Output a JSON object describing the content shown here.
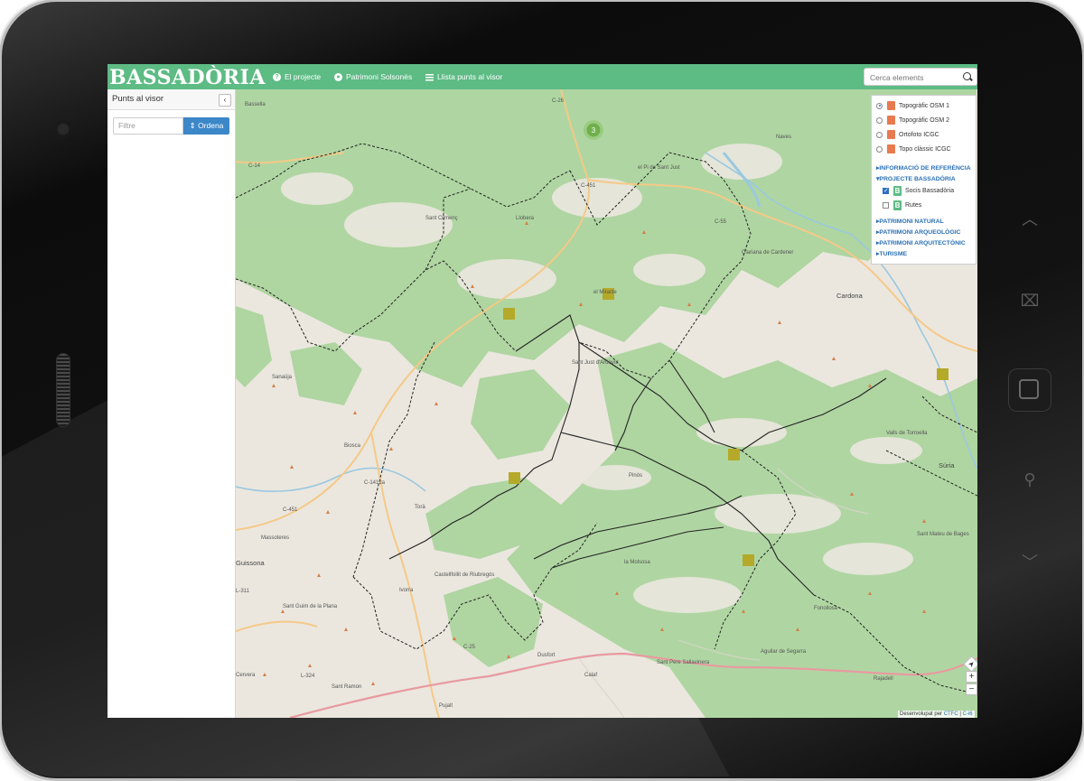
{
  "app": {
    "logo": "BASSADÒRIA"
  },
  "nav": {
    "items": [
      {
        "label": "El projecte",
        "icon": "question-icon"
      },
      {
        "label": "Patrimoni Solsonès",
        "icon": "globe-icon"
      },
      {
        "label": "Llista punts al visor",
        "icon": "list-icon"
      }
    ],
    "search_placeholder": "Cerca elements"
  },
  "sidebar": {
    "title": "Punts al visor",
    "collapse_symbol": "‹",
    "filter_placeholder": "Filtre",
    "sort_label": "Ordena"
  },
  "layers": {
    "base": [
      {
        "label": "Topogràfic OSM 1",
        "selected": true
      },
      {
        "label": "Topogràfic OSM 2",
        "selected": false
      },
      {
        "label": "Ortofoto ICGC",
        "selected": false
      },
      {
        "label": "Topo clàssic ICGC",
        "selected": false
      }
    ],
    "sections": [
      {
        "label": "INFORMACIÓ DE REFERÈNCIA",
        "expanded": false
      },
      {
        "label": "PROJECTE BASSADÒRIA",
        "expanded": true
      },
      {
        "label": "PATRIMONI NATURAL",
        "expanded": false
      },
      {
        "label": "PATRIMONI ARQUEOLÒGIC",
        "expanded": false
      },
      {
        "label": "PATRIMONI ARQUITECTÒNIC",
        "expanded": false
      },
      {
        "label": "TURISME",
        "expanded": false
      }
    ],
    "overlays": [
      {
        "label": "Socis Bassadòria",
        "checked": true
      },
      {
        "label": "Rutes",
        "checked": false
      }
    ]
  },
  "map": {
    "cluster_count": "3",
    "towns": [
      "Bassella",
      "Naves",
      "el Pi de Sant Just",
      "Sant Climenç",
      "Llobera",
      "Clariana de Cardener",
      "el Miracle",
      "Cardona",
      "Sant Just d'Ardèvol",
      "Sanaüja",
      "Biosca",
      "Valls de Torroella",
      "Súria",
      "Pinós",
      "Torà",
      "Massoteres",
      "Guissona",
      "Sant Mateu de Bages",
      "la Molsosa",
      "Castellfollit de Riubregós",
      "Ivorra",
      "Sant Guim de la Plana",
      "Fonollosa",
      "Dusfort",
      "Calaf",
      "Sant Pere Sallavinera",
      "Aguilar de Segarra",
      "Rajadell",
      "Sant Ramon",
      "Pujalt",
      "Cervera"
    ],
    "roads": [
      "C-26",
      "C-14",
      "C-451",
      "C-55",
      "C-1412a",
      "C-451",
      "L-311",
      "C-25",
      "L-324"
    ]
  },
  "controls": {
    "locate": "➤",
    "zoom_in": "+",
    "zoom_out": "−"
  },
  "attribution": {
    "prefix": "Desenvolupat per",
    "link1": "CTFC",
    "sep": " | ",
    "link2": "C-i6"
  },
  "hardware": {
    "up": "︿",
    "down": "﹀",
    "bookmark": "⌧",
    "search": "⚲"
  },
  "colors": {
    "brand": "#5dbb84",
    "accent": "#3b87c8",
    "forest": "#a8d59a",
    "land": "#ebe7df"
  }
}
